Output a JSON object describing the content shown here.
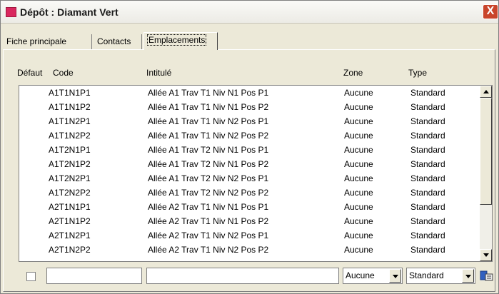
{
  "window": {
    "title": "Dépôt : Diamant Vert",
    "close_label": "X"
  },
  "tabs": [
    {
      "label": "Fiche principale"
    },
    {
      "label": "Contacts"
    },
    {
      "label": "Emplacements",
      "active": true
    }
  ],
  "columns": {
    "default": "Défaut",
    "code": "Code",
    "label": "Intitulé",
    "zone": "Zone",
    "type": "Type"
  },
  "rows": [
    {
      "code": "A1T1N1P1",
      "label": "Allée A1 Trav T1 Niv N1 Pos P1",
      "zone": "Aucune",
      "type": "Standard"
    },
    {
      "code": "A1T1N1P2",
      "label": "Allée A1 Trav T1 Niv N1 Pos P2",
      "zone": "Aucune",
      "type": "Standard"
    },
    {
      "code": "A1T1N2P1",
      "label": "Allée A1 Trav T1 Niv N2 Pos P1",
      "zone": "Aucune",
      "type": "Standard"
    },
    {
      "code": "A1T1N2P2",
      "label": "Allée A1 Trav T1 Niv N2 Pos P2",
      "zone": "Aucune",
      "type": "Standard"
    },
    {
      "code": "A1T2N1P1",
      "label": "Allée A1 Trav T2 Niv N1 Pos P1",
      "zone": "Aucune",
      "type": "Standard"
    },
    {
      "code": "A1T2N1P2",
      "label": "Allée A1 Trav T2 Niv N1 Pos P2",
      "zone": "Aucune",
      "type": "Standard"
    },
    {
      "code": "A1T2N2P1",
      "label": "Allée A1 Trav T2 Niv N2 Pos P1",
      "zone": "Aucune",
      "type": "Standard"
    },
    {
      "code": "A1T2N2P2",
      "label": "Allée A1 Trav T2 Niv N2 Pos P2",
      "zone": "Aucune",
      "type": "Standard"
    },
    {
      "code": "A2T1N1P1",
      "label": "Allée A2 Trav T1 Niv N1 Pos P1",
      "zone": "Aucune",
      "type": "Standard"
    },
    {
      "code": "A2T1N1P2",
      "label": "Allée A2 Trav T1 Niv N1 Pos P2",
      "zone": "Aucune",
      "type": "Standard"
    },
    {
      "code": "A2T1N2P1",
      "label": "Allée A2 Trav T1 Niv N2 Pos P1",
      "zone": "Aucune",
      "type": "Standard"
    },
    {
      "code": "A2T1N2P2",
      "label": "Allée A2 Trav T1 Niv N2 Pos P2",
      "zone": "Aucune",
      "type": "Standard"
    }
  ],
  "editor": {
    "default_checked": false,
    "code_value": "",
    "label_value": "",
    "zone_value": "Aucune",
    "type_value": "Standard"
  },
  "icons": {
    "app": "app-icon",
    "close": "close-icon",
    "tool": "edit-record-icon"
  }
}
